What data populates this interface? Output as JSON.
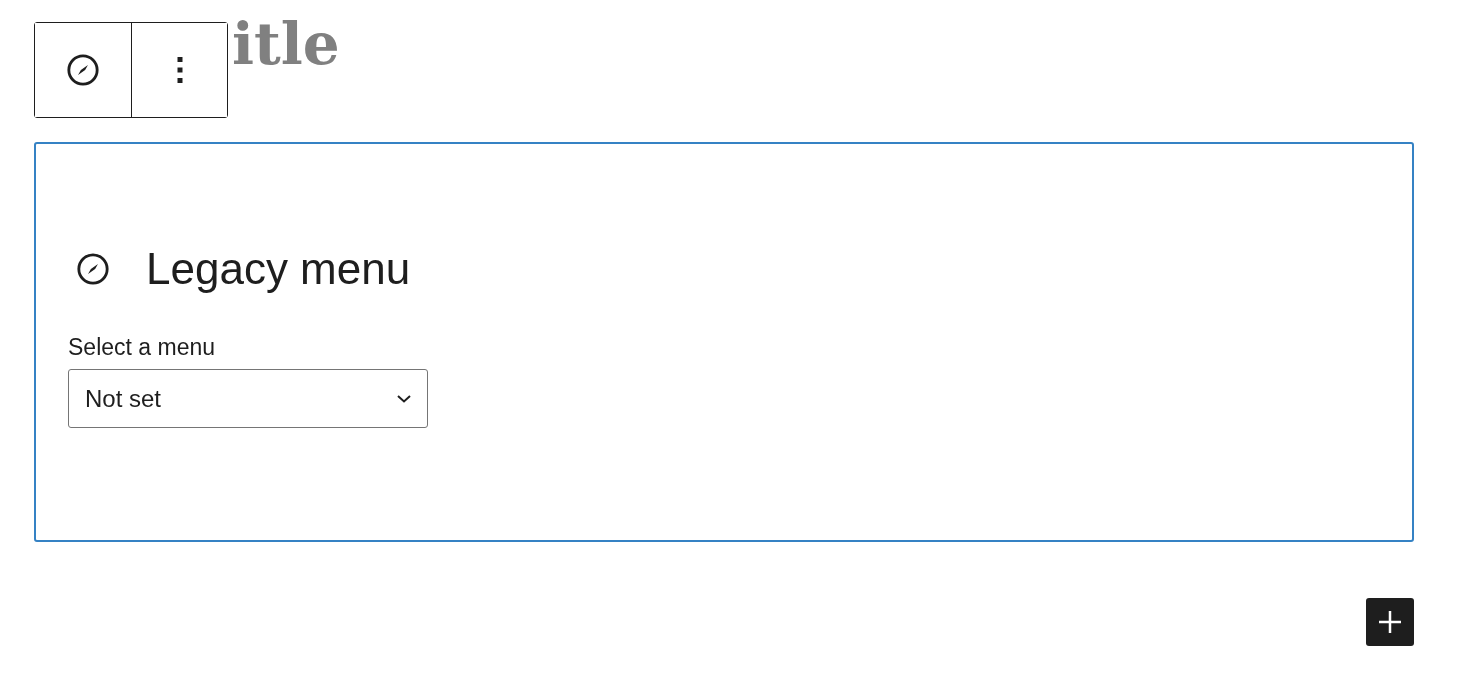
{
  "post_title": {
    "visible_text": "itle"
  },
  "block_toolbar": {
    "buttons": [
      {
        "kind": "block-type"
      },
      {
        "kind": "options"
      }
    ]
  },
  "legacy_menu_block": {
    "selected": true,
    "heading": "Legacy menu",
    "select": {
      "label": "Select a menu",
      "value": "Not set"
    }
  },
  "inserter": {
    "kind": "add"
  }
}
